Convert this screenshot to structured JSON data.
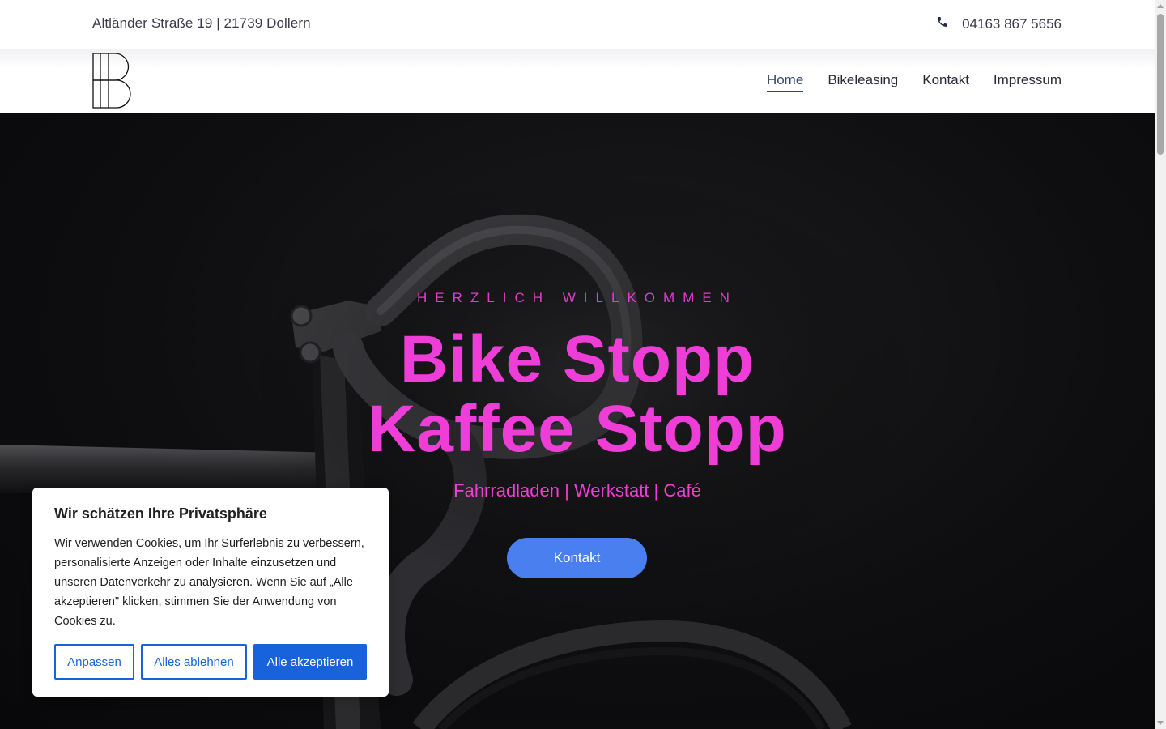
{
  "topbar": {
    "address": "Altländer Straße 19 | 21739 Dollern",
    "phone": "04163 867 5656",
    "phone_icon": "phone-icon"
  },
  "header": {
    "logo": "bike-stopp-logo",
    "nav": [
      {
        "label": "Home",
        "active": true
      },
      {
        "label": "Bikeleasing",
        "active": false
      },
      {
        "label": "Kontakt",
        "active": false
      },
      {
        "label": "Impressum",
        "active": false
      }
    ]
  },
  "hero": {
    "eyebrow": "HERZLICH WILLKOMMEN",
    "title_line1": "Bike Stopp",
    "title_line2": "Kaffee Stopp",
    "subtitle": "Fahrradladen | Werkstatt | Café",
    "button_label": "Kontakt",
    "accent_color": "#ef3dd7",
    "button_color": "#4a7ff0"
  },
  "cookie_banner": {
    "title": "Wir schätzen Ihre Privatsphäre",
    "text": "Wir verwenden Cookies, um Ihr Surferlebnis zu verbessern, personalisierte Anzeigen oder Inhalte einzusetzen und unseren Datenverkehr zu analysieren. Wenn Sie auf „Alle akzeptieren\" klicken, stimmen Sie der Anwendung von Cookies zu.",
    "customize_label": "Anpassen",
    "reject_label": "Alles ablehnen",
    "accept_label": "Alle akzeptieren",
    "button_color": "#1863dc"
  }
}
